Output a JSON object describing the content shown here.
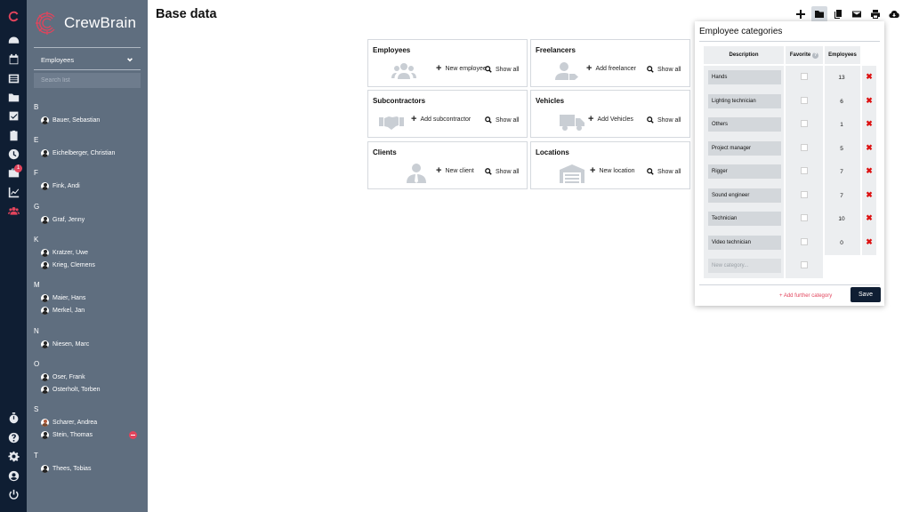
{
  "app": {
    "logo_text": "CrewBrain",
    "brand_color": "#e2445c",
    "rail_color": "#0f1e33",
    "sidebar_color": "#5f6e7f"
  },
  "rail": {
    "top_icons": [
      "crewbrain-logo-icon",
      "dashboard-icon",
      "calendar-icon",
      "list-icon",
      "folder-icon",
      "checkbox-icon",
      "clipboard-icon",
      "clock-icon",
      "suitcase-icon",
      "chart-icon",
      "users-icon"
    ],
    "suitcase_badge": "1",
    "bottom_icons": [
      "stopwatch-icon",
      "help-icon",
      "settings-icon",
      "profile-icon",
      "power-icon"
    ]
  },
  "sidebar": {
    "dropdown_label": "Employees",
    "search_placeholder": "Search list",
    "groups": [
      {
        "letter": "B",
        "people": [
          {
            "name": "Bauer, Sebastian"
          }
        ]
      },
      {
        "letter": "E",
        "people": [
          {
            "name": "Eichelberger, Christian"
          }
        ]
      },
      {
        "letter": "F",
        "people": [
          {
            "name": "Fink, Andi"
          }
        ]
      },
      {
        "letter": "G",
        "people": [
          {
            "name": "Graf, Jenny"
          }
        ]
      },
      {
        "letter": "K",
        "people": [
          {
            "name": "Kratzer, Uwe"
          },
          {
            "name": "Krieg, Clemens"
          }
        ]
      },
      {
        "letter": "M",
        "people": [
          {
            "name": "Maier, Hans"
          },
          {
            "name": "Merkel, Jan"
          }
        ]
      },
      {
        "letter": "N",
        "people": [
          {
            "name": "Niesen, Marc"
          }
        ]
      },
      {
        "letter": "O",
        "people": [
          {
            "name": "Oser, Frank"
          },
          {
            "name": "Osterholt, Torben"
          }
        ]
      },
      {
        "letter": "S",
        "people": [
          {
            "name": "Scharer, Andrea"
          },
          {
            "name": "Stein, Thomas"
          }
        ]
      },
      {
        "letter": "T",
        "people": [
          {
            "name": "Thees, Tobias"
          }
        ]
      }
    ]
  },
  "header": {
    "title": "Base data",
    "toolbar_icons": [
      "plus-icon",
      "folder-icon",
      "copy-icon",
      "mail-icon",
      "print-icon",
      "cloud-download-icon"
    ]
  },
  "cards": {
    "employees": {
      "title": "Employees",
      "action": "New employee",
      "show_all": "Show all"
    },
    "freelancers": {
      "title": "Freelancers",
      "action": "Add freelancer",
      "show_all": "Show all"
    },
    "subcontractors": {
      "title": "Subcontractors",
      "action": "Add subcontractor",
      "show_all": "Show all"
    },
    "vehicles": {
      "title": "Vehicles",
      "action": "Add Vehicles",
      "show_all": "Show all"
    },
    "clients": {
      "title": "Clients",
      "action": "New client",
      "show_all": "Show all"
    },
    "locations": {
      "title": "Locations",
      "action": "New location",
      "show_all": "Show all"
    }
  },
  "popup": {
    "title": "Employee categories",
    "col_description": "Description",
    "col_favorite": "Favorite",
    "col_employees": "Employees",
    "categories": [
      {
        "name": "Hands",
        "employees": "13"
      },
      {
        "name": "Lighting technician",
        "employees": "6"
      },
      {
        "name": "Others",
        "employees": "1"
      },
      {
        "name": "Project manager",
        "employees": "5"
      },
      {
        "name": "Rigger",
        "employees": "7"
      },
      {
        "name": "Sound engineer",
        "employees": "7"
      },
      {
        "name": "Technician",
        "employees": "10"
      },
      {
        "name": "Video technician",
        "employees": "0"
      }
    ],
    "new_placeholder": "New category...",
    "add_further": "+ Add further category",
    "save_label": "Save"
  }
}
